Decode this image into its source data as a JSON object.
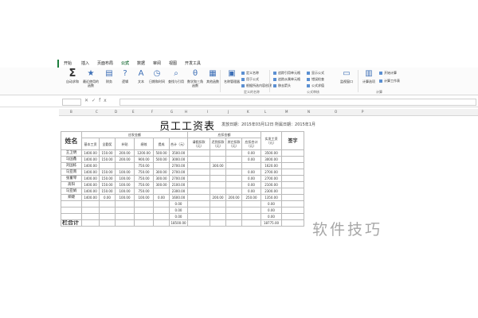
{
  "ribbon": {
    "tabs": [
      "开始",
      "插入",
      "页面布局",
      "公式",
      "数据",
      "审阅",
      "视图",
      "开发工具"
    ],
    "active_tab": "公式",
    "buttons": [
      "自动求和",
      "最近使用的函数",
      "财务",
      "逻辑",
      "文本",
      "日期和时间",
      "查找与引用",
      "数学和三角函数",
      "其他函数",
      "名称管理器"
    ],
    "defined_names": [
      "定义名称",
      "用于公式",
      "根据所选内容创建"
    ],
    "group_names": [
      "定义的名称",
      "公式审核",
      "计算"
    ],
    "audit": [
      "追踪引用单元格",
      "追踪从属单元格",
      "移去箭头",
      "显示公式",
      "错误检查",
      "公式求值"
    ],
    "watch": "监视窗口",
    "calc": [
      "计算选项",
      "开始计算",
      "计算工作表"
    ],
    "accent_color": "#1e7e3e"
  },
  "formula_bar": {
    "fx": "fx"
  },
  "columns": [
    "B",
    "C",
    "D",
    "E",
    "F",
    "G",
    "H",
    "I",
    "J",
    "K",
    "L",
    "M",
    "N",
    "O",
    "P"
  ],
  "sheet": {
    "title": "员工工资表",
    "date_info": "发放日期：2015年03月12日  所属日期：2015年1月"
  },
  "table": {
    "name_header": "姓名",
    "yingfa": "应发金额",
    "yingkou": "应扣金额",
    "net_header": "实发工资（元）",
    "sign_header": "签字",
    "sub_headers": [
      "基本工资",
      "全勤奖",
      "补贴",
      "绩效",
      "提成",
      "合计（元）"
    ],
    "deduct_headers": [
      "请假扣款（元）",
      "迟到扣款（元）",
      "其它扣款（元）",
      "应扣合计（元）"
    ],
    "rows": [
      {
        "name": "王卫明",
        "v": [
          "1400.00",
          "150.00",
          "200.00",
          "1200.00",
          "500.00",
          "3500.00",
          "",
          "",
          "",
          "0.00",
          "3500.00",
          ""
        ]
      },
      {
        "name": "马国鑫",
        "v": [
          "1400.00",
          "150.00",
          "200.00",
          "900.00",
          "500.00",
          "3000.00",
          "",
          "",
          "",
          "0.00",
          "3000.00",
          ""
        ]
      },
      {
        "name": "刘国栋",
        "v": [
          "1400.00",
          "",
          "",
          "750.00",
          "",
          "2700.00",
          "",
          "",
          "",
          "",
          "1620.00",
          ""
        ]
      },
      {
        "name": "马亚南",
        "v": [
          "1400.00",
          "150.00",
          "100.00",
          "750.00",
          "300.00",
          "2700.00",
          "",
          "",
          "",
          "0.00",
          "2700.00",
          ""
        ]
      },
      {
        "name": "张董琴",
        "v": [
          "1400.00",
          "150.00",
          "100.00",
          "750.00",
          "300.00",
          "2700.00",
          "",
          "",
          "",
          "0.00",
          "2700.00",
          ""
        ]
      },
      {
        "name": "高阳",
        "v": [
          "1400.00",
          "150.00",
          "100.00",
          "750.00",
          "300.00",
          "2100.00",
          "",
          "",
          "",
          "0.00",
          "2100.00",
          ""
        ]
      },
      {
        "name": "马亚娟",
        "v": [
          "1400.00",
          "150.00",
          "100.00",
          "750.00",
          "",
          "2300.00",
          "",
          "",
          "",
          "0.00",
          "2300.00",
          ""
        ]
      },
      {
        "name": "郑婕",
        "v": [
          "1400.00",
          "0.00",
          "100.00",
          "100.00",
          "0.00",
          "1600.00",
          "",
          "",
          "",
          "",
          "1350.00",
          ""
        ]
      },
      {
        "name": "",
        "v": [
          "",
          "",
          "",
          "",
          "",
          "0.00",
          "",
          "",
          "",
          "",
          "0.00",
          ""
        ]
      },
      {
        "name": "",
        "v": [
          "",
          "",
          "",
          "",
          "",
          "0.00",
          "",
          "",
          "",
          "",
          "0.00",
          ""
        ]
      },
      {
        "name": "",
        "v": [
          "",
          "",
          "",
          "",
          "",
          "0.00",
          "",
          "",
          "",
          "",
          "0.00",
          ""
        ]
      }
    ],
    "extra": {
      "r2_i": "",
      "r2_l": "300.00",
      "r7_j": "200.00",
      "r7_k": "200.00",
      "r7_l": "250.00"
    },
    "total_label": "栏合计",
    "total_f": "18500.00",
    "total_net": "18775.00"
  },
  "watermark": "软件技巧"
}
